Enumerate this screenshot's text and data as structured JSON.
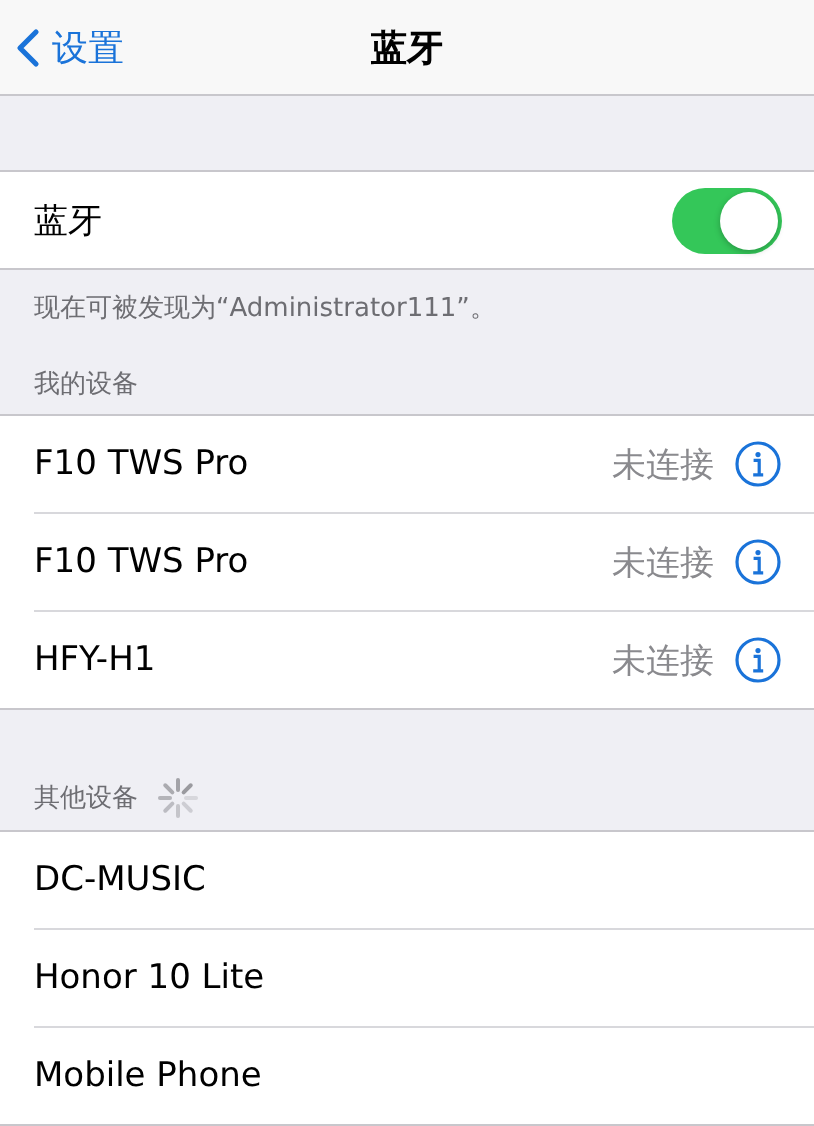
{
  "nav": {
    "back": "设置",
    "title": "蓝牙"
  },
  "bluetooth": {
    "label": "蓝牙",
    "on": true,
    "footer": "现在可被发现为“Administrator111”。"
  },
  "my_devices": {
    "header": "我的设备",
    "items": [
      {
        "name": "F10 TWS Pro",
        "status": "未连接"
      },
      {
        "name": "F10 TWS Pro",
        "status": "未连接"
      },
      {
        "name": "HFY-H1",
        "status": "未连接"
      }
    ]
  },
  "other_devices": {
    "header": "其他设备",
    "searching": true,
    "items": [
      {
        "name": "DC-MUSIC"
      },
      {
        "name": "Honor 10 Lite"
      },
      {
        "name": "Mobile Phone"
      }
    ]
  }
}
